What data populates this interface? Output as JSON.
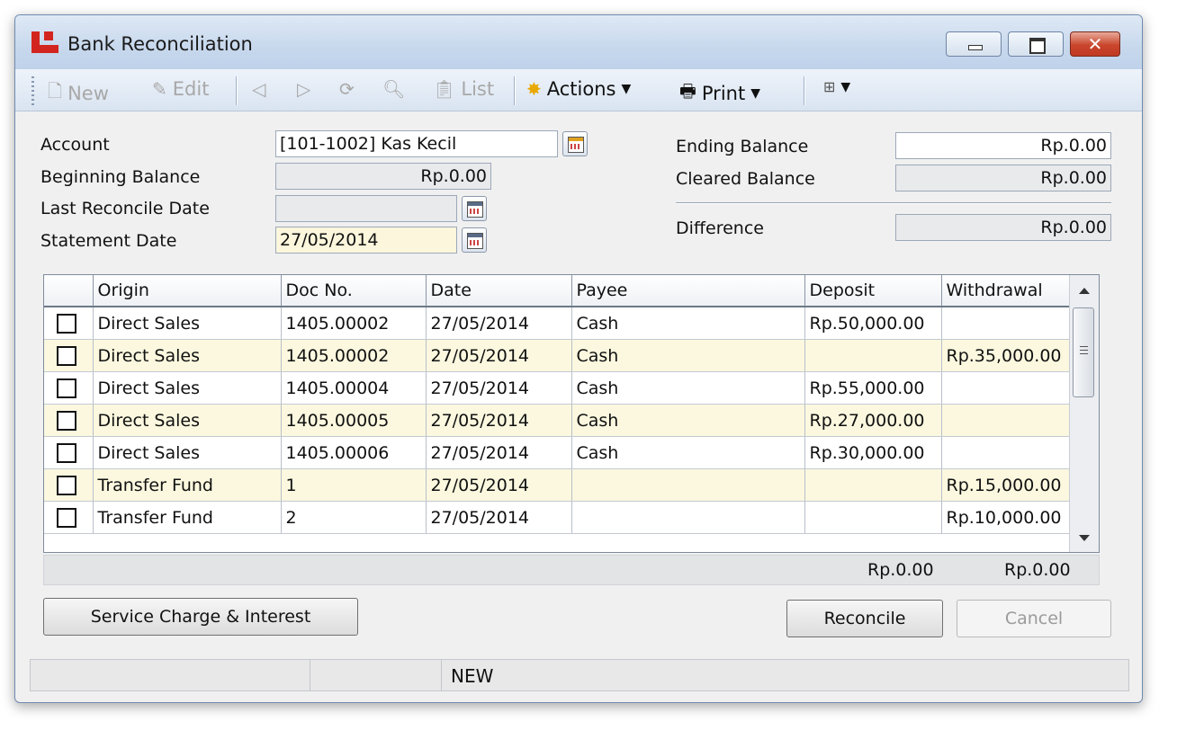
{
  "window": {
    "title": "Bank Reconciliation"
  },
  "toolbar": {
    "new_label": "New",
    "edit_label": "Edit",
    "list_label": "List",
    "actions_label": "Actions",
    "print_label": "Print"
  },
  "form": {
    "account_label": "Account",
    "account_value": "[101-1002] Kas Kecil",
    "beginning_balance_label": "Beginning Balance",
    "beginning_balance_value": "Rp.0.00",
    "last_reconcile_label": "Last Reconcile Date",
    "last_reconcile_value": "",
    "statement_date_label": "Statement Date",
    "statement_date_value": "27/05/2014",
    "ending_balance_label": "Ending Balance",
    "ending_balance_value": "Rp.0.00",
    "cleared_balance_label": "Cleared Balance",
    "cleared_balance_value": "Rp.0.00",
    "difference_label": "Difference",
    "difference_value": "Rp.0.00"
  },
  "grid": {
    "columns": [
      "Origin",
      "Doc No.",
      "Date",
      "Payee",
      "Deposit",
      "Withdrawal"
    ],
    "rows": [
      {
        "origin": "Direct Sales",
        "doc_no": "1405.00002",
        "date": "27/05/2014",
        "payee": "Cash",
        "deposit": "Rp.50,000.00",
        "withdrawal": ""
      },
      {
        "origin": "Direct Sales",
        "doc_no": "1405.00002",
        "date": "27/05/2014",
        "payee": "Cash",
        "deposit": "",
        "withdrawal": "Rp.35,000.00"
      },
      {
        "origin": "Direct Sales",
        "doc_no": "1405.00004",
        "date": "27/05/2014",
        "payee": "Cash",
        "deposit": "Rp.55,000.00",
        "withdrawal": ""
      },
      {
        "origin": "Direct Sales",
        "doc_no": "1405.00005",
        "date": "27/05/2014",
        "payee": "Cash",
        "deposit": "Rp.27,000.00",
        "withdrawal": ""
      },
      {
        "origin": "Direct Sales",
        "doc_no": "1405.00006",
        "date": "27/05/2014",
        "payee": "Cash",
        "deposit": "Rp.30,000.00",
        "withdrawal": ""
      },
      {
        "origin": "Transfer Fund",
        "doc_no": "1",
        "date": "27/05/2014",
        "payee": "",
        "deposit": "",
        "withdrawal": "Rp.15,000.00"
      },
      {
        "origin": "Transfer Fund",
        "doc_no": "2",
        "date": "27/05/2014",
        "payee": "",
        "deposit": "",
        "withdrawal": "Rp.10,000.00"
      }
    ],
    "total_deposit": "Rp.0.00",
    "total_withdrawal": "Rp.0.00"
  },
  "buttons": {
    "service_charge": "Service Charge & Interest",
    "reconcile": "Reconcile",
    "cancel": "Cancel"
  },
  "status": {
    "mode": "NEW"
  },
  "colors": {
    "accent": "#d3251f",
    "alt_row": "#fbf8df"
  }
}
